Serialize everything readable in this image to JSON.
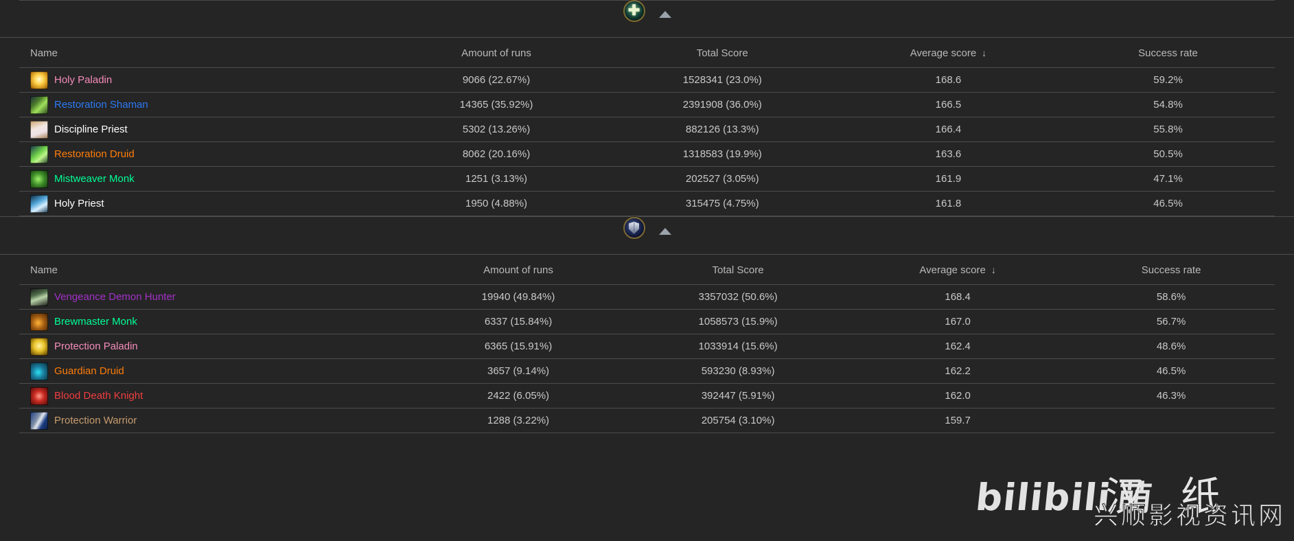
{
  "columns": [
    "Name",
    "Amount of runs",
    "Total Score",
    "Average score",
    "Success rate"
  ],
  "sort": {
    "column": "Average score",
    "arrow": "↓",
    "direction": "descending"
  },
  "sections": [
    {
      "role": "healer",
      "role_icon": "healer-plus-icon",
      "collapse_icon": "collapse-caret-icon",
      "rows": [
        {
          "icon": "ic-holypal",
          "icon_name": "spec-icon-holy-paladin",
          "name": "Holy Paladin",
          "color": "#F58CBA",
          "runs": "9066 (22.67%)",
          "total": "1528341 (23.0%)",
          "avg": "168.6",
          "success": "59.2%"
        },
        {
          "icon": "ic-restsham",
          "icon_name": "spec-icon-restoration-shaman",
          "name": "Restoration Shaman",
          "color": "#2C7AF5",
          "runs": "14365 (35.92%)",
          "total": "2391908 (36.0%)",
          "avg": "166.5",
          "success": "54.8%"
        },
        {
          "icon": "ic-discpri",
          "icon_name": "spec-icon-discipline-priest",
          "name": "Discipline Priest",
          "color": "#FFFFFF",
          "runs": "5302 (13.26%)",
          "total": "882126 (13.3%)",
          "avg": "166.4",
          "success": "55.8%"
        },
        {
          "icon": "ic-restdru",
          "icon_name": "spec-icon-restoration-druid",
          "name": "Restoration Druid",
          "color": "#FF7D0A",
          "runs": "8062 (20.16%)",
          "total": "1318583 (19.9%)",
          "avg": "163.6",
          "success": "50.5%"
        },
        {
          "icon": "ic-mistmonk",
          "icon_name": "spec-icon-mistweaver-monk",
          "name": "Mistweaver Monk",
          "color": "#00FF96",
          "runs": "1251 (3.13%)",
          "total": "202527 (3.05%)",
          "avg": "161.9",
          "success": "47.1%"
        },
        {
          "icon": "ic-holypri",
          "icon_name": "spec-icon-holy-priest",
          "name": "Holy Priest",
          "color": "#FFFFFF",
          "runs": "1950 (4.88%)",
          "total": "315475 (4.75%)",
          "avg": "161.8",
          "success": "46.5%"
        }
      ]
    },
    {
      "role": "tank",
      "role_icon": "tank-shield-icon",
      "collapse_icon": "collapse-caret-icon",
      "rows": [
        {
          "icon": "ic-vengdh",
          "icon_name": "spec-icon-vengeance-demon-hunter",
          "name": "Vengeance Demon Hunter",
          "color": "#A330C9",
          "runs": "19940 (49.84%)",
          "total": "3357032 (50.6%)",
          "avg": "168.4",
          "success": "58.6%"
        },
        {
          "icon": "ic-brewmonk",
          "icon_name": "spec-icon-brewmaster-monk",
          "name": "Brewmaster Monk",
          "color": "#00FF96",
          "runs": "6337 (15.84%)",
          "total": "1058573 (15.9%)",
          "avg": "167.0",
          "success": "56.7%"
        },
        {
          "icon": "ic-protpal",
          "icon_name": "spec-icon-protection-paladin",
          "name": "Protection Paladin",
          "color": "#F58CBA",
          "runs": "6365 (15.91%)",
          "total": "1033914 (15.6%)",
          "avg": "162.4",
          "success": "48.6%"
        },
        {
          "icon": "ic-guarddru",
          "icon_name": "spec-icon-guardian-druid",
          "name": "Guardian Druid",
          "color": "#FF7D0A",
          "runs": "3657 (9.14%)",
          "total": "593230 (8.93%)",
          "avg": "162.2",
          "success": "46.5%"
        },
        {
          "icon": "ic-blooddk",
          "icon_name": "spec-icon-blood-death-knight",
          "name": "Blood Death Knight",
          "color": "#F03C40",
          "runs": "2422 (6.05%)",
          "total": "392447 (5.91%)",
          "avg": "162.0",
          "success": "46.3%"
        },
        {
          "icon": "ic-protwar",
          "icon_name": "spec-icon-protection-warrior",
          "name": "Protection Warrior",
          "color": "#C79C6E",
          "runs": "1288 (3.22%)",
          "total": "205754 (3.10%)",
          "avg": "159.7",
          "success": ""
        }
      ]
    }
  ],
  "watermarks": {
    "bilibili": "bilibili",
    "bilibili_cn": "萌",
    "cn_big": "汉纸",
    "cn_small": "兴顺影视资讯网"
  }
}
